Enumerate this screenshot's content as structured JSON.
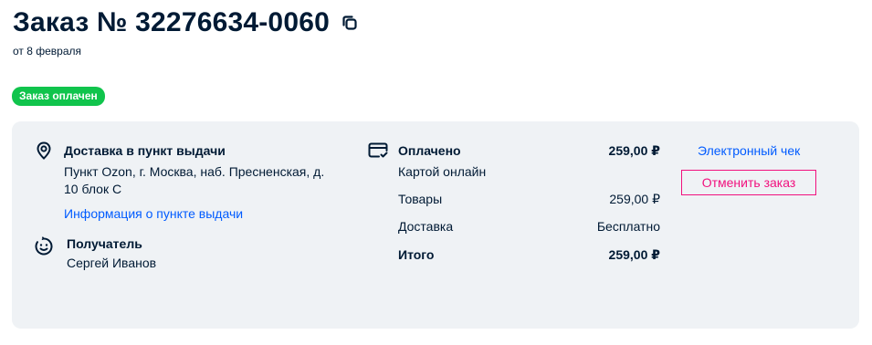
{
  "header": {
    "title": "Заказ № 32276634-0060",
    "date": "от 8 февраля",
    "status": "Заказ оплачен"
  },
  "delivery": {
    "title": "Доставка в пункт выдачи",
    "address_line1": "Пункт Ozon, г. Москва, наб. Пресненская, д.",
    "address_line2": "10 блок С",
    "info_link": "Информация о пункте выдачи"
  },
  "recipient": {
    "title": "Получатель",
    "name": "Сергей Иванов"
  },
  "payment": {
    "status": "Оплачено",
    "status_amount": "259,00 ₽",
    "method": "Картой онлайн",
    "items_label": "Товары",
    "items_amount": "259,00 ₽",
    "delivery_label": "Доставка",
    "delivery_amount": "Бесплатно",
    "total_label": "Итого",
    "total_amount": "259,00 ₽"
  },
  "actions": {
    "receipt_link": "Электронный чек",
    "cancel_button": "Отменить заказ"
  },
  "colors": {
    "accent": "#005bff",
    "badge": "#10c44c",
    "danger": "#f1117e",
    "panel_bg": "#eff2f5",
    "text": "#001a34"
  },
  "icons": {
    "copy": "copy-icon",
    "location": "location-pin-icon",
    "recipient": "smiley-face-icon",
    "payment": "credit-card-check-icon"
  }
}
